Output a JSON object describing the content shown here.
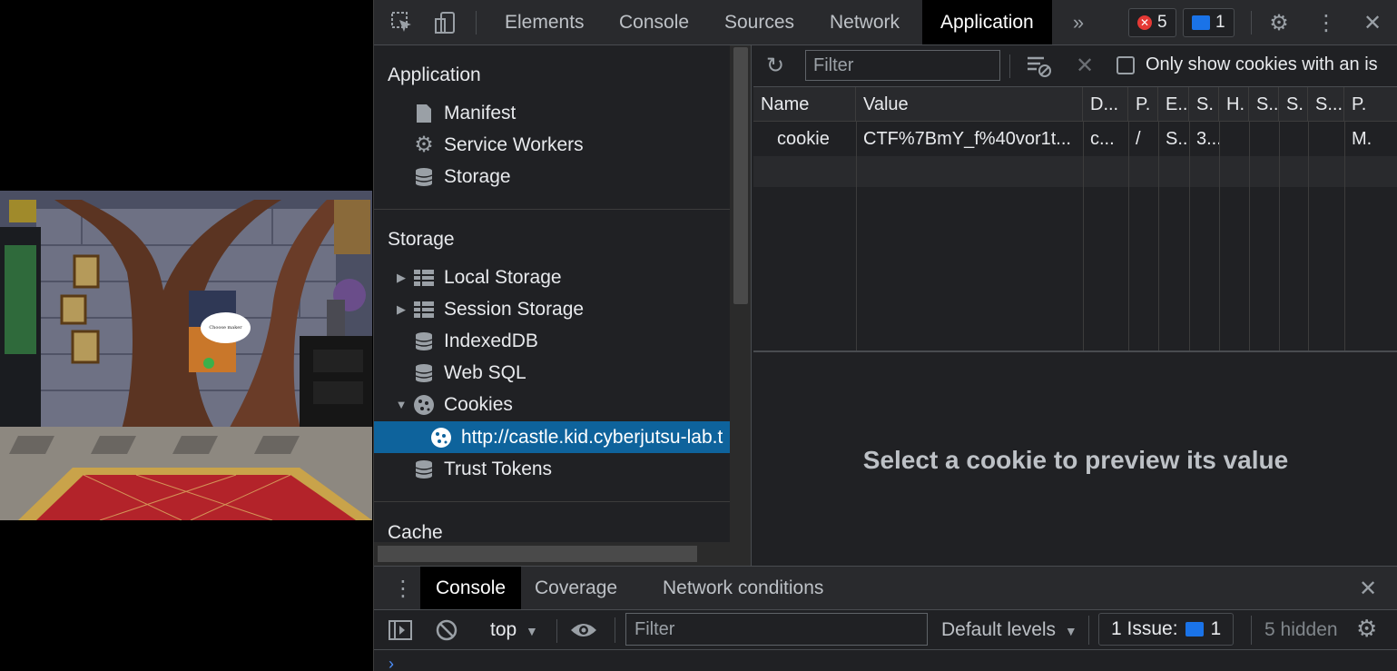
{
  "page": {
    "speech_bubble": "Choose maker"
  },
  "devtools": {
    "tabs": [
      {
        "label": "Elements"
      },
      {
        "label": "Console"
      },
      {
        "label": "Sources"
      },
      {
        "label": "Network"
      },
      {
        "label": "Application"
      }
    ],
    "active_tab": "Application",
    "errors_count": "5",
    "messages_count": "1",
    "colors": {
      "accent": "#0e639c",
      "error": "#e53935",
      "info": "#1a73e8"
    }
  },
  "sidebar": {
    "application_title": "Application",
    "application_items": [
      {
        "label": "Manifest",
        "icon": "file-icon"
      },
      {
        "label": "Service Workers",
        "icon": "gear-icon"
      },
      {
        "label": "Storage",
        "icon": "database-icon"
      }
    ],
    "storage_title": "Storage",
    "storage_items": [
      {
        "label": "Local Storage",
        "icon": "grid-icon"
      },
      {
        "label": "Session Storage",
        "icon": "grid-icon"
      },
      {
        "label": "IndexedDB",
        "icon": "database-icon"
      },
      {
        "label": "Web SQL",
        "icon": "database-icon"
      },
      {
        "label": "Cookies",
        "icon": "cookie-icon"
      },
      {
        "label": "http://castle.kid.cyberjutsu-lab.t",
        "icon": "cookie-icon"
      },
      {
        "label": "Trust Tokens",
        "icon": "database-icon"
      }
    ],
    "cache_title": "Cache"
  },
  "cookies": {
    "filter_placeholder": "Filter",
    "only_issue_label": "Only show cookies with an is",
    "columns": [
      "Name",
      "Value",
      "D...",
      "P.",
      "E..",
      "S.",
      "H.",
      "S..",
      "S.",
      "S...",
      "P."
    ],
    "rows": [
      [
        "cookie",
        "CTF%7BmY_f%40vor1t...",
        "c...",
        "/",
        "S...",
        "3...",
        "",
        "",
        "",
        "",
        "M."
      ]
    ],
    "preview_text": "Select a cookie to preview its value"
  },
  "drawer": {
    "tabs": [
      {
        "label": "Console"
      },
      {
        "label": "Coverage"
      },
      {
        "label": "Network conditions"
      }
    ],
    "context": "top",
    "filter_placeholder": "Filter",
    "levels": "Default levels",
    "issues_label": "1 Issue:",
    "issues_count": "1",
    "hidden_label": "5 hidden"
  }
}
